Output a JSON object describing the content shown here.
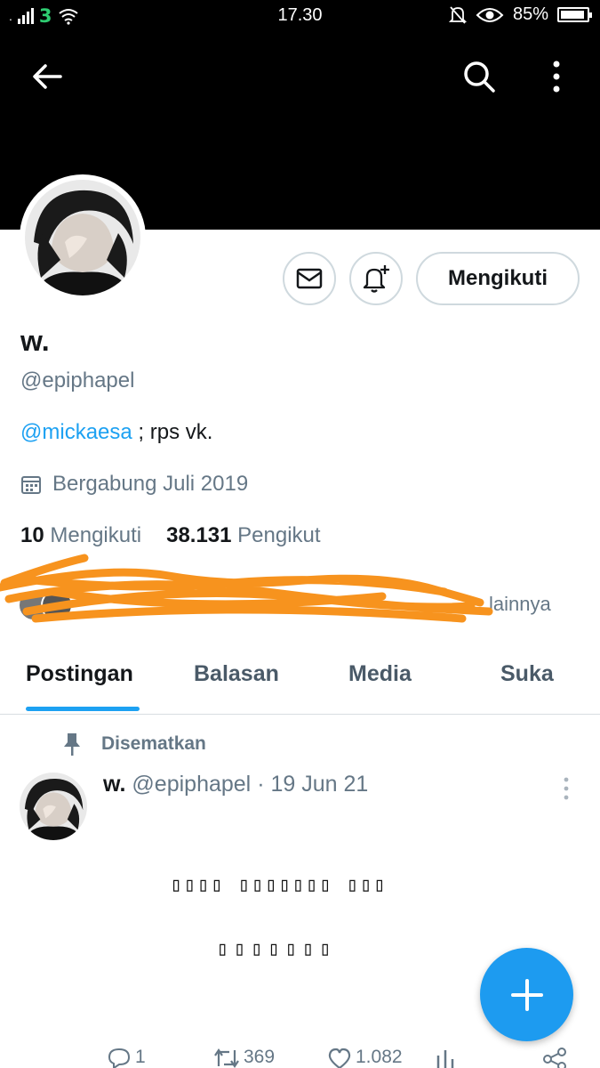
{
  "status_bar": {
    "carrier": "3",
    "time": "17.30",
    "battery": "85%"
  },
  "header": {
    "back_icon": "arrow-left-icon",
    "search_icon": "search-icon",
    "more_icon": "more-vertical-icon"
  },
  "actions": {
    "message_icon": "envelope-icon",
    "notify_icon": "bell-plus-icon",
    "follow_label": "Mengikuti"
  },
  "profile": {
    "name": "w.",
    "handle": "@epiphapel",
    "bio_mention": "@mickaesa",
    "bio_text": " ; rps vk.",
    "joined": "Bergabung Juli 2019",
    "following_count": "10",
    "following_label": "Mengikuti",
    "followers_count": "38.131",
    "followers_label": "Pengikut",
    "known_followers_suffix": "lainnya"
  },
  "tabs": [
    {
      "label": "Postingan",
      "active": true
    },
    {
      "label": "Balasan",
      "active": false
    },
    {
      "label": "Media",
      "active": false
    },
    {
      "label": "Suka",
      "active": false
    }
  ],
  "tweet": {
    "pinned_label": "Disematkan",
    "author_name": "w.",
    "author_handle": "@epiphapel",
    "separator": "·",
    "date": "19 Jun 21",
    "line1": "▯▯▯▯ ▯▯▯▯▯▯▯ ▯▯▯",
    "line2": "▯▯▯▯▯▯▯",
    "replies": "1",
    "retweets": "369",
    "likes": "1.082"
  },
  "colors": {
    "accent": "#1da1f2",
    "fab": "#1d9bf0",
    "scribble": "#f7931e",
    "muted": "#657786"
  }
}
